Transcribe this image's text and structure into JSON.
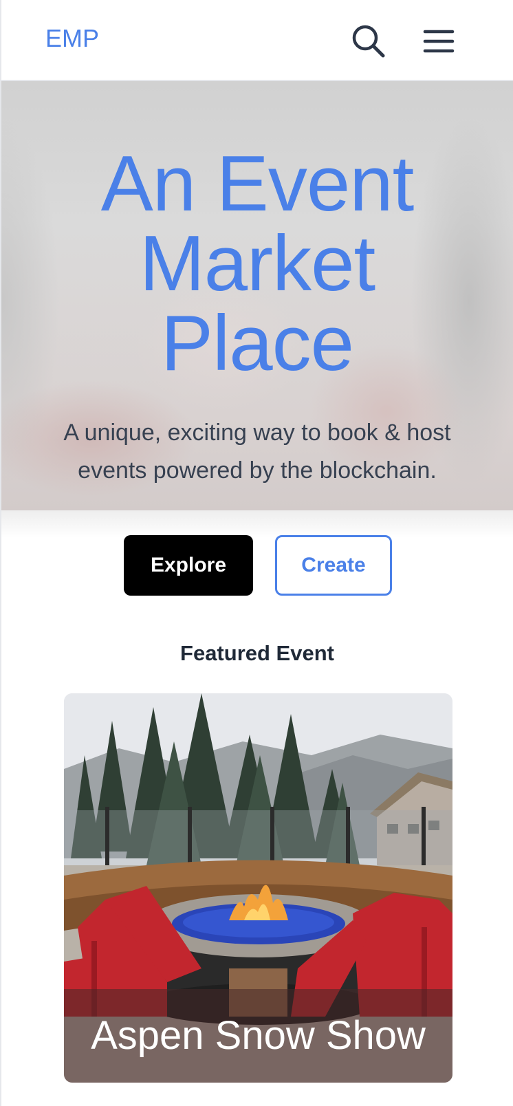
{
  "header": {
    "brand": "EMP",
    "search_icon": "search-icon",
    "menu_icon": "hamburger-menu-icon"
  },
  "hero": {
    "title_lines": [
      "An Event",
      "Market",
      "Place"
    ],
    "subtitle": "A unique, exciting way to book & host events powered by the blockchain."
  },
  "actions": {
    "explore_label": "Explore",
    "create_label": "Create"
  },
  "featured": {
    "heading": "Featured Event",
    "event": {
      "title": "Aspen Snow Show",
      "image": "outdoor-fire-pit-with-red-adirondack-chairs"
    }
  },
  "colors": {
    "accent": "#4a80e8",
    "text_dark": "#1f2937",
    "text_muted": "#374151",
    "button_dark": "#000000"
  }
}
